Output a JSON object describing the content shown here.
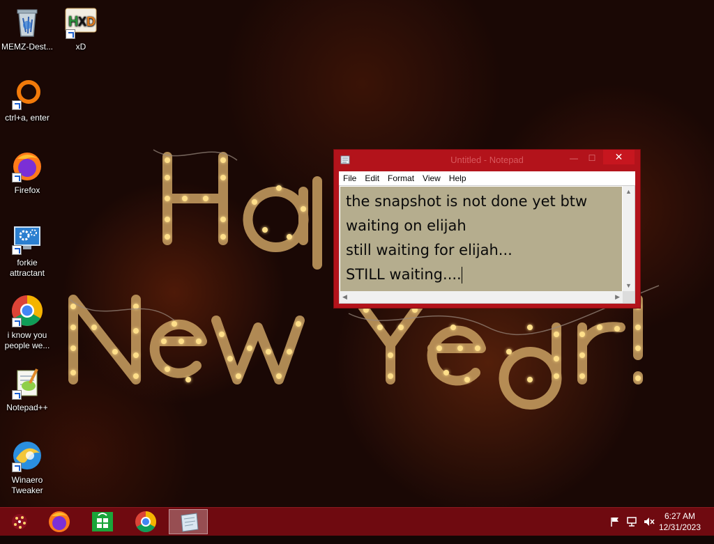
{
  "desktop": {
    "wallpaper": {
      "line1": "Happy",
      "line2": "New Year!",
      "bulb_color": "#ffdf8a",
      "frame_color": "#c9a062"
    },
    "icons": [
      {
        "label": "MEMZ-Dest...",
        "icon": "recycle-bin-icon"
      },
      {
        "label": "xD",
        "icon": "hxd-icon"
      },
      {
        "label": "ctrl+a, enter",
        "icon": "orange-ring-icon"
      },
      {
        "label": "Firefox",
        "icon": "firefox-icon"
      },
      {
        "label": "forkie attractant",
        "icon": "monitor-gear-icon"
      },
      {
        "label": "i know you people we...",
        "icon": "chrome-icon"
      },
      {
        "label": "Notepad++",
        "icon": "notepadpp-icon"
      },
      {
        "label": "Winaero Tweaker",
        "icon": "winaero-icon"
      }
    ]
  },
  "notepad": {
    "title": "Untitled - Notepad",
    "close_label": "✕",
    "minimize_label": "—",
    "maximize_label": "☐",
    "menu": [
      "File",
      "Edit",
      "Format",
      "View",
      "Help"
    ],
    "lines": [
      "the snapshot is not done yet btw",
      "waiting on elijah",
      "still waiting for elijah...",
      "STILL waiting...."
    ],
    "text_background": "#b5ad8e",
    "frame_color": "#b3131b"
  },
  "taskbar": {
    "color": "#6f0a10",
    "apps": [
      "start-orb-icon",
      "firefox-icon",
      "store-icon",
      "chrome-icon",
      "notepad-icon"
    ],
    "active_app": "notepad-icon",
    "tray": [
      "flag-icon",
      "network-icon",
      "volume-muted-icon"
    ],
    "time": "6:27 AM",
    "date": "12/31/2023"
  }
}
